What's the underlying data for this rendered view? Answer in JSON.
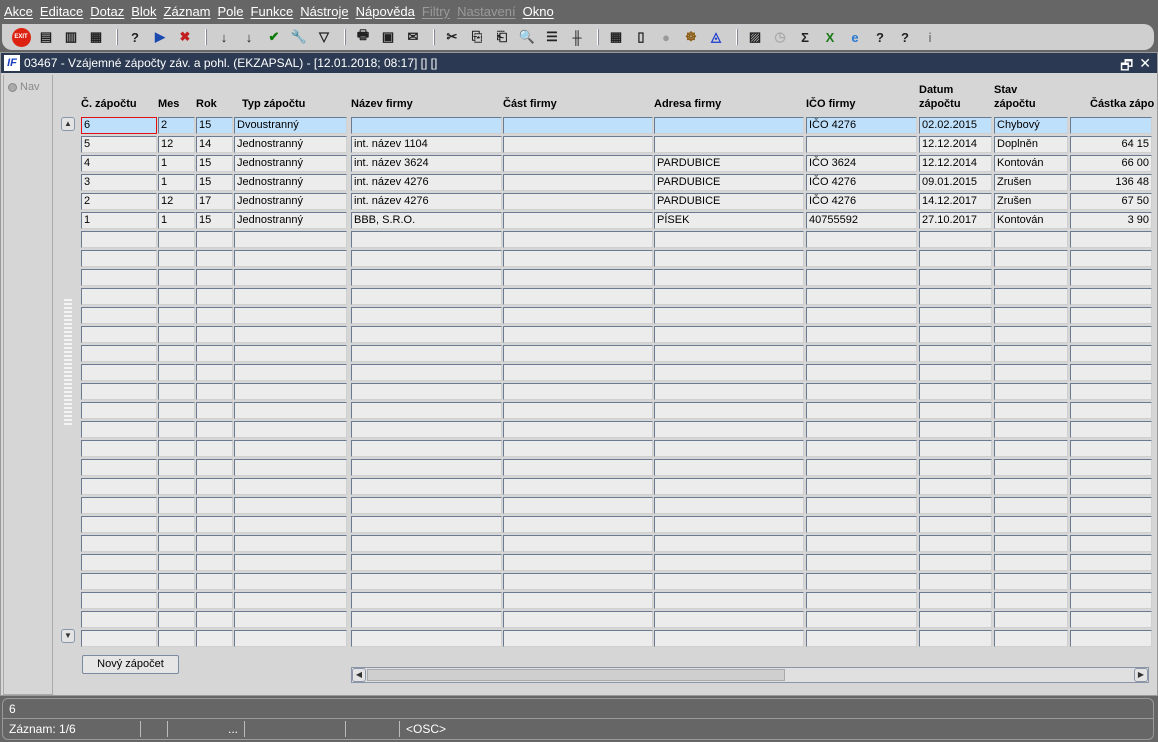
{
  "menu": [
    "Akce",
    "Editace",
    "Dotaz",
    "Blok",
    "Záznam",
    "Pole",
    "Funkce",
    "Nástroje",
    "Nápověda",
    "Filtry",
    "Nastavení",
    "Okno"
  ],
  "menu_disabled": [
    "Filtry",
    "Nastavení"
  ],
  "toolbar": {
    "exit_label": "EXIT",
    "icons": [
      "exit",
      "new-record",
      "duplicate-record",
      "delete-record",
      "|",
      "query-enter",
      "query-execute",
      "query-cancel",
      "|",
      "sort-ascending",
      "sort-descending",
      "commit-check",
      "wrench",
      "filter",
      "|",
      "print",
      "print-setup",
      "send-mail",
      "|",
      "cut",
      "copy",
      "paste",
      "zoom",
      "list-indent",
      "tree",
      "|",
      "import",
      "document",
      "globe",
      "ship-wheel",
      "eye",
      "|",
      "chart",
      "clock",
      "sum",
      "excel",
      "internet-explorer",
      "help-context",
      "help",
      "info"
    ]
  },
  "window": {
    "title": "03467 - Vzájemné zápočty záv. a pohl. (EKZAPSAL) - [12.01.2018; 08:17]  [] []",
    "logo": "IF"
  },
  "nav": {
    "label": "Nav"
  },
  "grid": {
    "headers": [
      [
        "Č. zápočtu",
        ""
      ],
      [
        "Mes",
        ""
      ],
      [
        "Rok",
        ""
      ],
      [
        "Typ zápočtu",
        ""
      ],
      [
        "Název firmy",
        ""
      ],
      [
        "Část firmy",
        ""
      ],
      [
        "Adresa firmy",
        ""
      ],
      [
        "IČO firmy",
        ""
      ],
      [
        "Datum",
        "zápočtu"
      ],
      [
        "Stav",
        "zápočtu"
      ],
      [
        "Částka zápo",
        ""
      ]
    ],
    "rows": [
      [
        "6",
        "2",
        "15",
        "Dvoustranný",
        "",
        "",
        "",
        "IČO 4276",
        "02.02.2015",
        "Chybový",
        ""
      ],
      [
        "5",
        "12",
        "14",
        "Jednostranný",
        "int. název 1104",
        "",
        "",
        "",
        "12.12.2014",
        "Doplněn",
        "64 15"
      ],
      [
        "4",
        "1",
        "15",
        "Jednostranný",
        "int. název 3624",
        "",
        "PARDUBICE",
        "IČO 3624",
        "12.12.2014",
        "Kontován",
        "66 00"
      ],
      [
        "3",
        "1",
        "15",
        "Jednostranný",
        "int. název 4276",
        "",
        "PARDUBICE",
        "IČO 4276",
        "09.01.2015",
        "Zrušen",
        "136 48"
      ],
      [
        "2",
        "12",
        "17",
        "Jednostranný",
        "int. název 4276",
        "",
        "PARDUBICE",
        "IČO 4276",
        "14.12.2017",
        "Zrušen",
        "67 50"
      ],
      [
        "1",
        "1",
        "15",
        "Jednostranný",
        "BBB, S.R.O.",
        "",
        "PÍSEK",
        "40755592",
        "27.10.2017",
        "Kontován",
        "3 90"
      ]
    ],
    "selected_row": 0
  },
  "buttons": {
    "new": "Nový zápočet"
  },
  "status": {
    "field_value": "6",
    "record": "Záznam: 1/6",
    "ellipsis": "...",
    "mode": "<OSC>"
  }
}
